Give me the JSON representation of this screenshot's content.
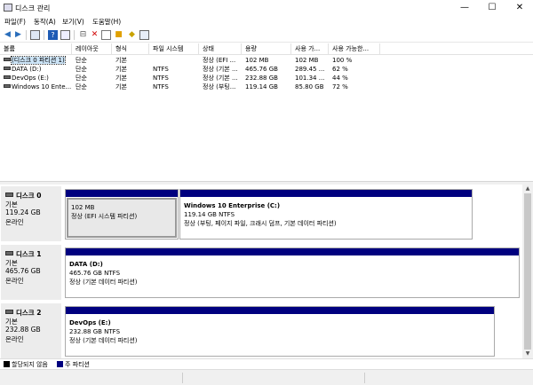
{
  "window": {
    "title": "디스크 관리",
    "min_glyph": "—",
    "max_glyph": "☐",
    "close_glyph": "✕"
  },
  "menu": [
    "파일(F)",
    "동작(A)",
    "보기(V)",
    "도움말(H)"
  ],
  "volume_table": {
    "columns": [
      "볼륨",
      "레이아웃",
      "형식",
      "파일 시스템",
      "상태",
      "용량",
      "사용 가...",
      "사용 가능한..."
    ],
    "rows": [
      {
        "volume": "(디스크 0 파티션 1)",
        "layout": "단순",
        "type": "기본",
        "fs": "",
        "status": "정상 (EFI ...",
        "capacity": "102 MB",
        "free": "102 MB",
        "pct": "100 %"
      },
      {
        "volume": "DATA (D:)",
        "layout": "단순",
        "type": "기본",
        "fs": "NTFS",
        "status": "정상 (기본 ...",
        "capacity": "465.76 GB",
        "free": "289.45 ...",
        "pct": "62 %"
      },
      {
        "volume": "DevOps (E:)",
        "layout": "단순",
        "type": "기본",
        "fs": "NTFS",
        "status": "정상 (기본 ...",
        "capacity": "232.88 GB",
        "free": "101.34 ...",
        "pct": "44 %"
      },
      {
        "volume": "Windows 10 Ente...",
        "layout": "단순",
        "type": "기본",
        "fs": "NTFS",
        "status": "정상 (부팅...",
        "capacity": "119.14 GB",
        "free": "85.80 GB",
        "pct": "72 %"
      }
    ]
  },
  "disks": [
    {
      "name": "디스크 0",
      "type": "기본",
      "size": "119.24 GB",
      "state": "온라인",
      "partitions": [
        {
          "title": "",
          "line1": "102 MB",
          "line2": "정상 (EFI 시스템 파티션)",
          "selected": true
        },
        {
          "title": "Windows 10 Enterprise  (C:)",
          "line1": "119.14 GB NTFS",
          "line2": "정상 (부팅, 페이지 파일, 크래시 덤프, 기본 데이터 파티션)",
          "selected": false
        }
      ]
    },
    {
      "name": "디스크 1",
      "type": "기본",
      "size": "465.76 GB",
      "state": "온라인",
      "partitions": [
        {
          "title": "DATA  (D:)",
          "line1": "465.76 GB NTFS",
          "line2": "정상 (기본 데이터 파티션)",
          "selected": false
        }
      ]
    },
    {
      "name": "디스크 2",
      "type": "기본",
      "size": "232.88 GB",
      "state": "온라인",
      "partitions": [
        {
          "title": "DevOps  (E:)",
          "line1": "232.88 GB NTFS",
          "line2": "정상 (기본 데이터 파티션)",
          "selected": false
        }
      ]
    }
  ],
  "legend": {
    "unallocated": "할당되지 않음",
    "primary": "주 파티션",
    "unallocated_color": "#000000",
    "primary_color": "#00007f"
  }
}
